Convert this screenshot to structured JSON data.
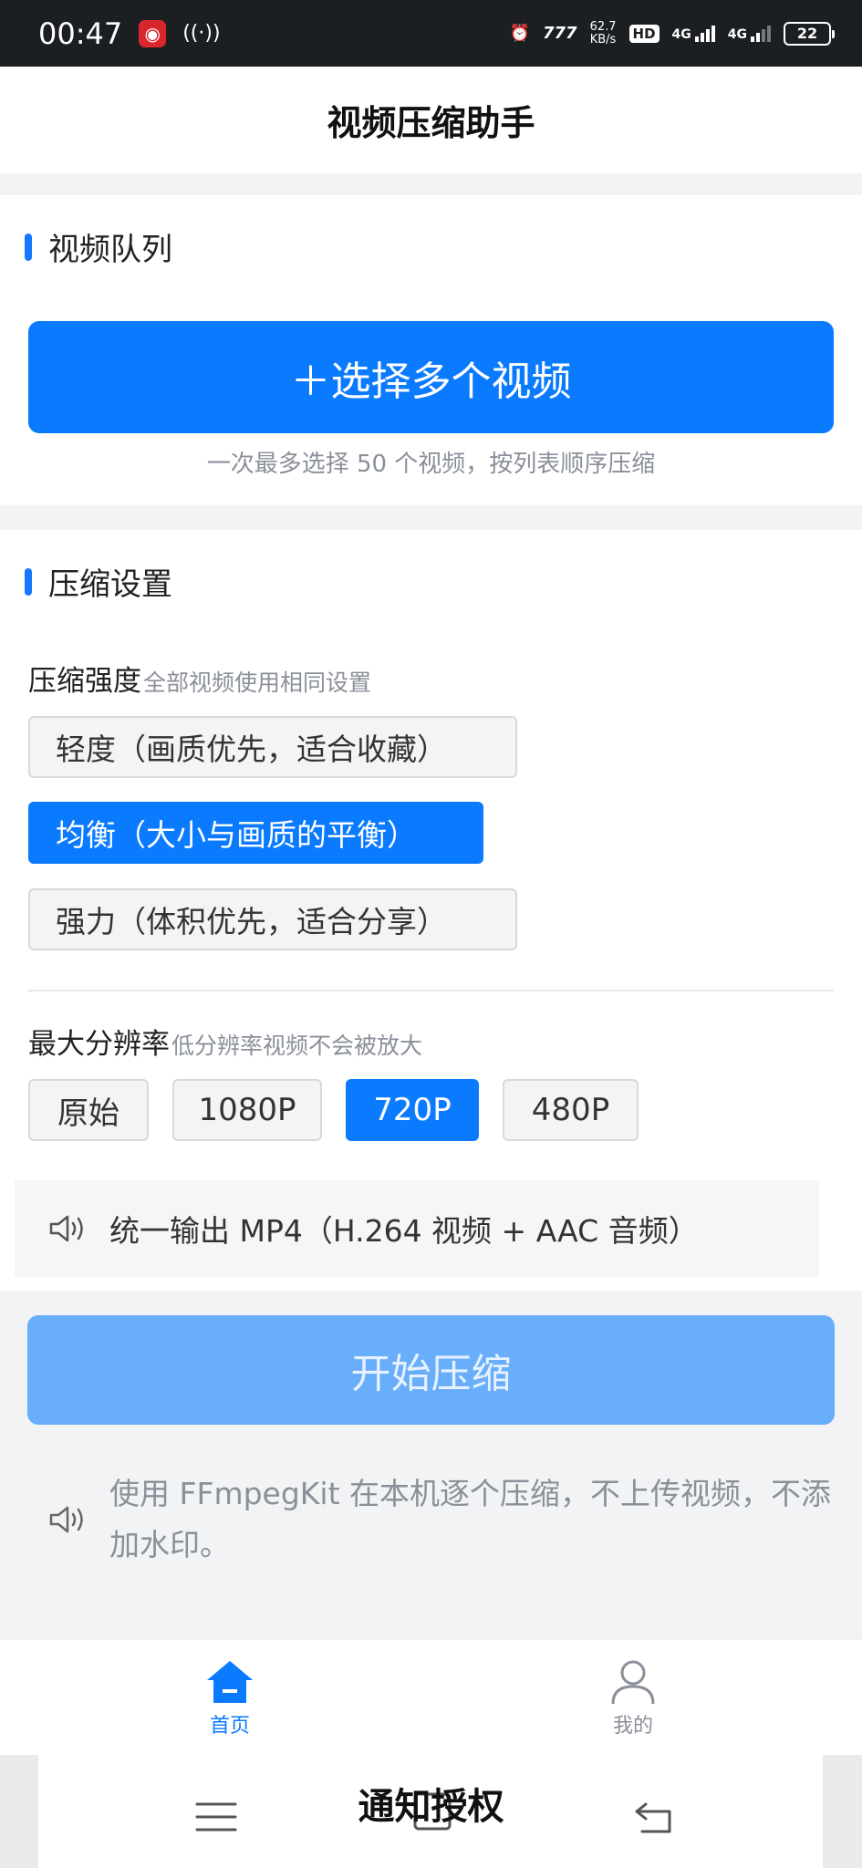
{
  "status_bar": {
    "time": "00:47",
    "net_speed_value": "62.7",
    "net_speed_unit": "KB/s",
    "hd_label": "HD",
    "net_label_1": "4G",
    "net_label_2": "4G",
    "battery": "22"
  },
  "header": {
    "title": "视频压缩助手"
  },
  "queue_section": {
    "title": "视频队列",
    "select_button": "＋选择多个视频",
    "hint": "一次最多选择 50 个视频，按列表顺序压缩"
  },
  "settings_section": {
    "title": "压缩设置",
    "strength_label": "压缩强度",
    "strength_sub": "全部视频使用相同设置",
    "strength_options": [
      {
        "label": "轻度（画质优先，适合收藏）",
        "selected": false
      },
      {
        "label": "均衡（大小与画质的平衡）",
        "selected": true
      },
      {
        "label": "强力（体积优先，适合分享）",
        "selected": false
      }
    ],
    "resolution_label": "最大分辨率",
    "resolution_sub": "低分辨率视频不会被放大",
    "resolution_options": [
      {
        "label": "原始",
        "selected": false
      },
      {
        "label": "1080P",
        "selected": false
      },
      {
        "label": "720P",
        "selected": true
      },
      {
        "label": "480P",
        "selected": false
      }
    ],
    "output_notice": "统一输出 MP4（H.264 视频 + AAC 音频）"
  },
  "start_button": "开始压缩",
  "footer_note": "使用 FFmpegKit 在本机逐个压缩，不上传视频，不添加水印。",
  "tab_bar": {
    "home": "首页",
    "me": "我的"
  },
  "toast": "通知授权",
  "colors": {
    "accent": "#0a7aff",
    "accent_disabled": "#68aefb",
    "muted_text": "#8a8f99"
  }
}
